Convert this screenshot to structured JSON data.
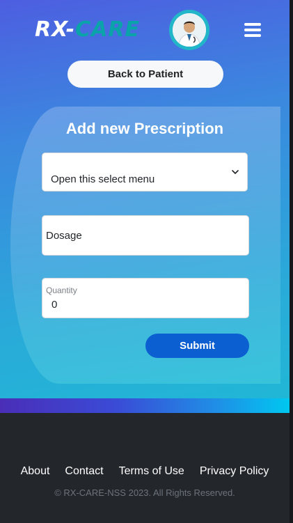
{
  "header": {
    "logo_part1": "RX-",
    "logo_part2": "CARE",
    "avatar_icon": "doctor-avatar",
    "menu_icon": "hamburger-icon"
  },
  "nav": {
    "back_label": "Back to Patient"
  },
  "form": {
    "title": "Add new Prescription",
    "select_value": "Open this select menu",
    "dosage_placeholder": "Dosage",
    "quantity_label": "Quantity",
    "quantity_value": "0",
    "submit_label": "Submit"
  },
  "footer": {
    "links": [
      "About",
      "Contact",
      "Terms of Use",
      "Privacy Policy"
    ],
    "copyright": "© RX-CARE-NSS 2023. All Rights Reserved."
  },
  "colors": {
    "accent": "#0b5fd0",
    "logo_accent": "#0aa3a9",
    "footer_bg": "#23262b"
  }
}
